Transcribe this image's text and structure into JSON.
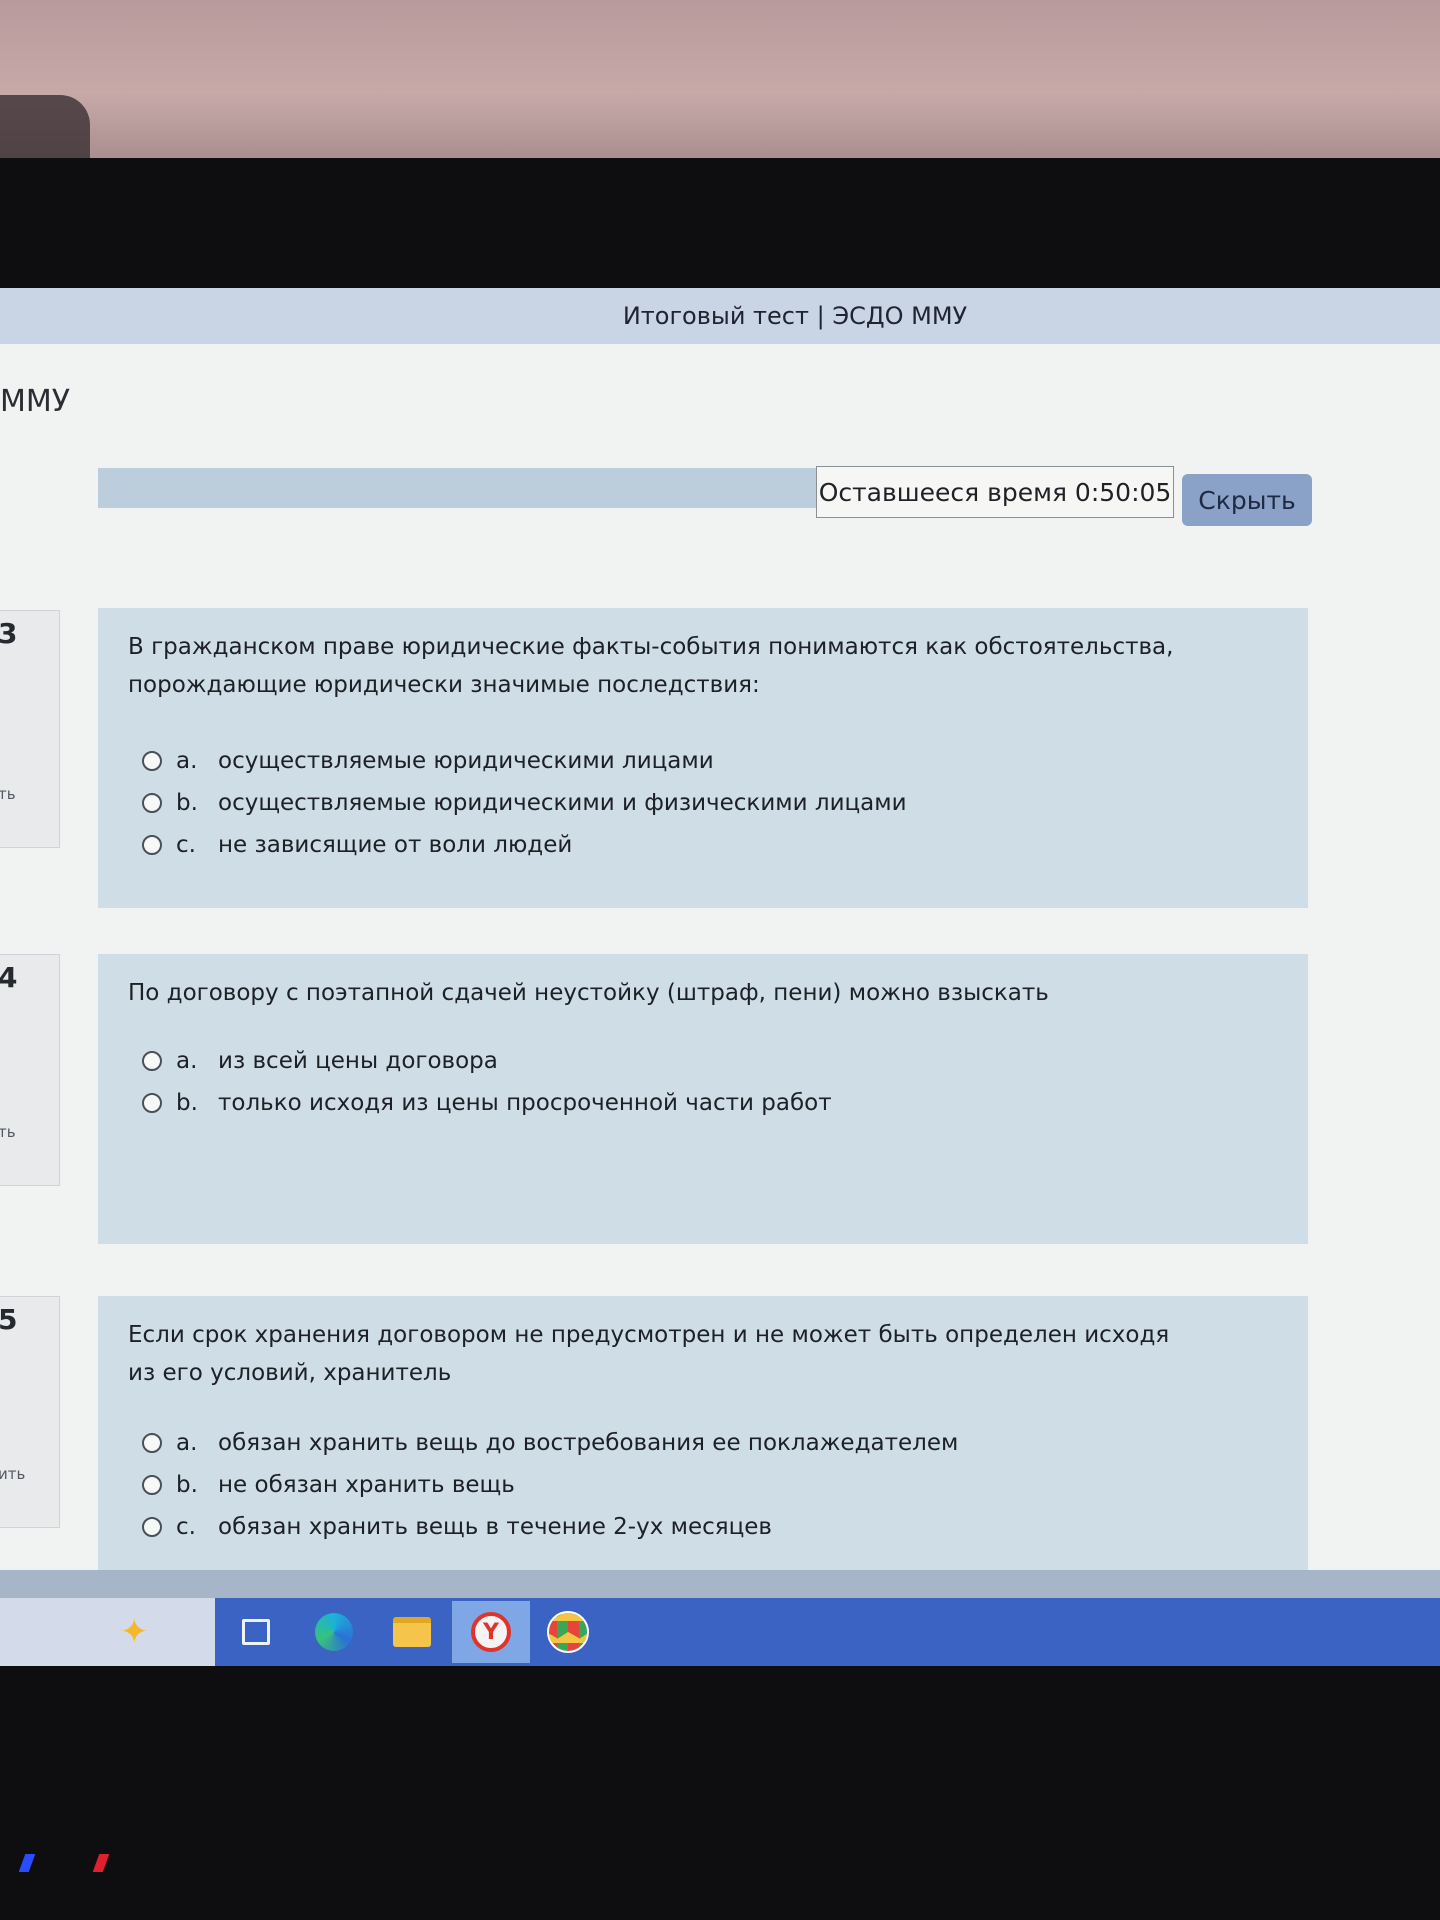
{
  "window": {
    "title": "Итоговый тест | ЭСДО ММУ"
  },
  "site": {
    "name_fragment": "ММУ"
  },
  "timer": {
    "text": "Оставшееся время 0:50:05",
    "hide_label": "Скрыть"
  },
  "questions": [
    {
      "number": "3",
      "side_fragment": "ть",
      "text": "В гражданском праве юридические факты-события понимаются как обстоятельства, порождающие юридически значимые последствия:",
      "answers": [
        {
          "letter": "a.",
          "text": "осуществляемые юридическими лицами"
        },
        {
          "letter": "b.",
          "text": "осуществляемые юридическими и физическими лицами"
        },
        {
          "letter": "c.",
          "text": "не зависящие от воли людей"
        }
      ]
    },
    {
      "number": "4",
      "side_fragment": "ть",
      "text": "По договору с поэтапной сдачей неустойку (штраф, пени) можно взыскать",
      "answers": [
        {
          "letter": "a.",
          "text": "из всей цены договора"
        },
        {
          "letter": "b.",
          "text": "только исходя из цены просроченной части работ"
        }
      ]
    },
    {
      "number": "5",
      "side_fragment": "ить",
      "text": "Если срок хранения договором не предусмотрен и не может быть определен исходя из его условий, хранитель",
      "answers": [
        {
          "letter": "a.",
          "text": "обязан хранить вещь до востребования ее поклажедателем"
        },
        {
          "letter": "b.",
          "text": "не обязан хранить вещь"
        },
        {
          "letter": "c.",
          "text": "обязан хранить вещь в течение 2-ух месяцев"
        }
      ]
    }
  ],
  "taskbar": {
    "icons": [
      "sparkle-icon",
      "task-view-icon",
      "edge-icon",
      "file-explorer-icon",
      "yandex-browser-icon",
      "chrome-icon"
    ]
  },
  "colors": {
    "card": "#cfdde6",
    "titlebar": "#c9d4e4",
    "hide_button": "#8aa1c8",
    "taskbar": "#3a63c4"
  }
}
